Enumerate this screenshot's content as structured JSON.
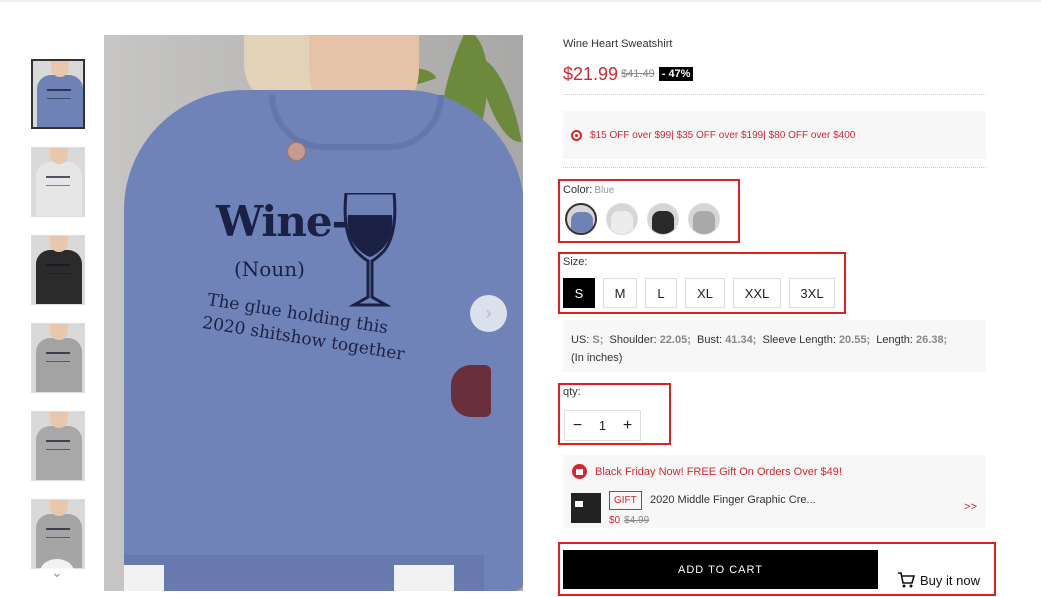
{
  "product": {
    "title": "Wine Heart Sweatshirt",
    "price": "$21.99",
    "old_price": "$41.49",
    "discount": "- 47%"
  },
  "promo": {
    "icon": "tag-icon",
    "text": "$15 OFF over $99| $35 OFF over $199| $80 OFF over $400"
  },
  "color": {
    "label": "Color:",
    "selected": "Blue",
    "swatches": [
      {
        "name": "Blue",
        "hex": "#6f82b6"
      },
      {
        "name": "White",
        "hex": "#ececec"
      },
      {
        "name": "Black",
        "hex": "#2a2a2a"
      },
      {
        "name": "Gray",
        "hex": "#a9a9a9"
      }
    ]
  },
  "size": {
    "label": "Size:",
    "options": [
      "S",
      "M",
      "L",
      "XL",
      "XXL",
      "3XL"
    ],
    "selected": "S"
  },
  "measurements": {
    "us_label": "US:",
    "us_value": "S;",
    "shoulder_label": "Shoulder:",
    "shoulder_value": "22.05;",
    "bust_label": "Bust:",
    "bust_value": "41.34;",
    "sleeve_label": "Sleeve Length:",
    "sleeve_value": "20.55;",
    "length_label": "Length:",
    "length_value": "26.38;",
    "unit_note": "(In inches)"
  },
  "qty": {
    "label": "qty:",
    "value": "1",
    "minus": "−",
    "plus": "+"
  },
  "gift": {
    "headline": "Black Friday Now! FREE Gift On Orders Over $49!",
    "tag": "GIFT",
    "name": "2020 Middle Finger Graphic Cre...",
    "price": "$0",
    "old_price": "$4.99",
    "more": ">>"
  },
  "actions": {
    "add_to_cart": "ADD TO CART",
    "buy_now": "Buy it now"
  },
  "image": {
    "print_big": "Wine-",
    "print_noun": "(Noun)",
    "print_line1": "The glue holding this",
    "print_line2": "2020 shitshow together",
    "next_arrow": "›",
    "thumbs_down": "⌄"
  },
  "thumbnails": [
    {
      "color": "#6f82b6",
      "active": true
    },
    {
      "color": "#e6e6e6",
      "active": false
    },
    {
      "color": "#2b2b2b",
      "active": false
    },
    {
      "color": "#a3a3a3",
      "active": false
    },
    {
      "color": "#a8a8a8",
      "active": false
    },
    {
      "color": "#a5a5a5",
      "active": false
    }
  ]
}
